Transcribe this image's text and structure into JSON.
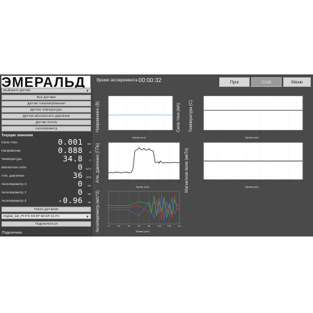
{
  "app": {
    "logo": "ЭМЕРАЛЬД",
    "experiment_label": "Время эксперимента",
    "experiment_time": "00:00:32",
    "buttons": {
      "start": "Пуск",
      "stop": "Стоп",
      "menu": "Меню"
    }
  },
  "sidebar": {
    "sensor_select": "Выберите датчик",
    "sensor_buttons": [
      "Все датчики",
      "Датчик тока/напряжения",
      "Датчик температуры",
      "Датчик абсолютного давления",
      "Датчик Холла",
      "Акселерометр"
    ],
    "section_title": "Текущие значения",
    "values": [
      {
        "label": "Сила тока",
        "value": "0.001",
        "unit": "мА"
      },
      {
        "label": "Напряжение",
        "value": "0.888",
        "unit": "В"
      },
      {
        "label": "Температура",
        "value": "34.8",
        "unit": "С"
      },
      {
        "label": "Магнитное поле",
        "value": "0",
        "unit": "мТл"
      },
      {
        "label": "Атм. давление",
        "value": "36",
        "unit": "kPa"
      },
      {
        "label": "Акселерометр X",
        "value": "0",
        "unit": "мс"
      },
      {
        "label": "Акселерометр Y",
        "value": "0",
        "unit": "мс"
      },
      {
        "label": "Акселерометр Z",
        "value": "-0.96",
        "unit": "мс"
      }
    ],
    "search_button": "Поиск датчиков",
    "device": "Digital_lab_PHYS   E8:9F:6D:5F:41:FA",
    "connect_button": "Подключиться",
    "status": "Подключено"
  },
  "colors": {
    "background": "#4a4a4a",
    "sidebar": "#3c3c3c",
    "plot_bg": "#ffffff",
    "voltage_line": "#4aa3df",
    "black_line": "#000000"
  },
  "chart_data": [
    {
      "type": "line",
      "ylabel": "Напряжение (В)",
      "xlabel": "Время (сек)",
      "x": [
        0,
        140
      ],
      "series": [
        {
          "values": [
            0.89,
            0.89
          ]
        }
      ],
      "color": "#4aa3df"
    },
    {
      "type": "line",
      "ylabel": "Сила тока (мА)",
      "xlabel": "",
      "series": []
    },
    {
      "type": "line",
      "ylabel": "Температура (С)",
      "xlabel": "Время (сек)",
      "x": [
        0,
        140
      ],
      "series": [
        {
          "values": [
            34.8,
            34.8
          ]
        }
      ]
    },
    {
      "type": "line",
      "ylabel": "Атм. давление (ГПа)",
      "xlabel": "Время (сек)",
      "x": [
        0,
        5,
        10,
        15,
        20,
        25,
        30,
        35,
        40,
        45,
        48,
        50,
        52,
        55,
        58,
        60,
        62,
        65,
        68,
        70,
        72,
        75,
        78,
        80,
        82,
        85,
        88,
        90,
        92,
        95,
        98,
        100,
        102,
        105,
        108,
        110,
        115,
        120,
        125,
        130,
        135,
        140
      ],
      "series": [
        {
          "values": [
            20,
            21,
            20,
            22,
            21,
            20,
            21,
            22,
            20,
            21,
            30,
            55,
            85,
            88,
            90,
            95,
            92,
            88,
            90,
            93,
            89,
            87,
            90,
            92,
            88,
            86,
            85,
            70,
            52,
            50,
            53,
            48,
            55,
            51,
            49,
            50,
            50,
            50,
            50,
            51,
            50,
            50
          ]
        }
      ]
    },
    {
      "type": "line",
      "ylabel": "Магнитное поле (мкТл)",
      "xlabel": "Время (сек)",
      "x": [
        0,
        140
      ],
      "series": [
        {
          "values": [
            0,
            0
          ]
        }
      ]
    },
    {
      "type": "line",
      "ylabel": "Акселерометр (м/с^2)",
      "xlabel": "Время (сек)",
      "x": [
        0,
        40,
        60,
        80,
        85,
        90,
        95,
        100,
        105,
        110,
        115,
        120,
        125,
        130,
        135,
        140
      ],
      "series": [
        {
          "color": "#d43c3c",
          "values": [
            0,
            0,
            1,
            -2,
            1,
            3,
            -3,
            5,
            -6,
            4,
            -2,
            1,
            -5,
            6,
            -1,
            0
          ]
        },
        {
          "color": "#3cb43c",
          "values": [
            1,
            1,
            3,
            2,
            -3,
            6,
            -4,
            3,
            -2,
            5,
            -5,
            2,
            -3,
            4,
            1,
            1
          ]
        },
        {
          "color": "#4a6ad4",
          "values": [
            -1,
            -1,
            -4,
            3,
            -2,
            -5,
            4,
            -3,
            6,
            -6,
            3,
            -4,
            5,
            -3,
            -1,
            -1
          ]
        }
      ]
    }
  ]
}
